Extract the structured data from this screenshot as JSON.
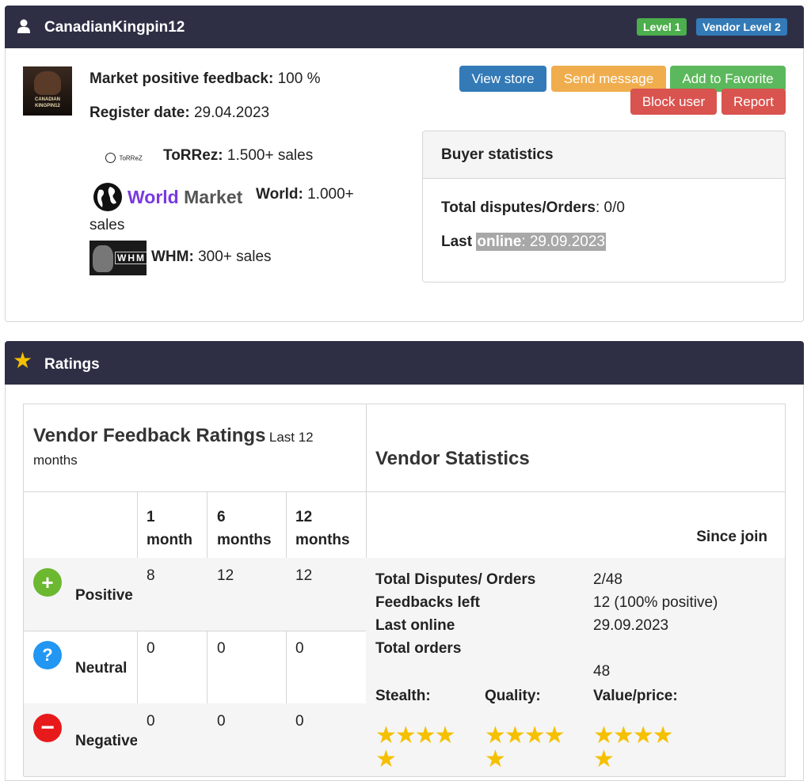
{
  "profile": {
    "username": "CanadianKingpin12",
    "badges": {
      "level": "Level 1",
      "vendor_level": "Vendor Level 2"
    },
    "avatar_text": "CANADIAN KINGPIN12",
    "feedback_label": "Market positive feedback:",
    "feedback_value": "100 %",
    "register_label": "Register date:",
    "register_value": "29.04.2023",
    "markets": [
      {
        "logo": "ToRReZ",
        "name": "ToRRez:",
        "value": "1.500+ sales"
      },
      {
        "logo_a": "World",
        "logo_b": "Market",
        "name": "World:",
        "value": "1.000+",
        "value_wrap": "sales"
      },
      {
        "logo": "WHM",
        "name": "WHM:",
        "value": "300+ sales"
      }
    ],
    "buttons": {
      "view_store": "View store",
      "send_message": "Send message",
      "add_favorite": "Add to Favorite",
      "block_user": "Block user",
      "report": "Report"
    },
    "buyer_stats": {
      "title": "Buyer statistics",
      "disputes_label": "Total disputes/Orders",
      "disputes_value": ": 0/0",
      "last_label": "Last",
      "online_label": "online",
      "online_value": ": 29.09.2023"
    }
  },
  "ratings": {
    "title": "Ratings",
    "feedback_title": "Vendor Feedback Ratings",
    "feedback_sub_1": "Last 12",
    "feedback_sub_2": "months",
    "periods": [
      [
        "1",
        "month"
      ],
      [
        "6",
        "months"
      ],
      [
        "12",
        "months"
      ]
    ],
    "rows": [
      {
        "label": "Positive",
        "icon": "+",
        "values": [
          "8",
          "12",
          "12"
        ]
      },
      {
        "label": "Neutral",
        "icon": "?",
        "values": [
          "0",
          "0",
          "0"
        ]
      },
      {
        "label": "Negative",
        "icon": "−",
        "values": [
          "0",
          "0",
          "0"
        ]
      }
    ],
    "vendor_stats": {
      "title": "Vendor Statistics",
      "since_join": "Since join",
      "items": [
        {
          "label": "Total Disputes/ Orders",
          "value": "2/48"
        },
        {
          "label": "Feedbacks left",
          "value": "12 (100% positive)"
        },
        {
          "label": "Last online",
          "value": "29.09.2023"
        },
        {
          "label": "Total orders",
          "value": "48"
        }
      ],
      "stealth_label": "Stealth:",
      "quality_label": "Quality:",
      "value_label": "Value/price:",
      "stealth_stars": 5,
      "quality_stars": 5,
      "value_stars": 5,
      "star_glyph_row1": "★★★★",
      "star_glyph_row2": "★"
    }
  }
}
